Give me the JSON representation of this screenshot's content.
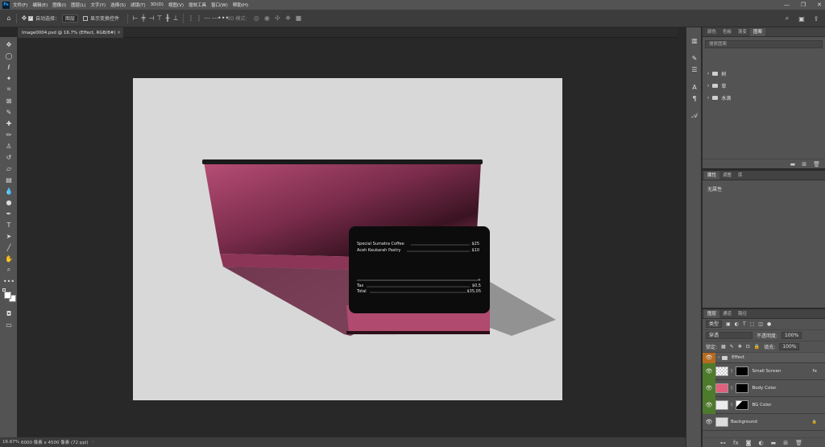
{
  "app": {
    "logo": "Ps"
  },
  "menu": [
    "文件(F)",
    "编辑(E)",
    "图像(I)",
    "图层(L)",
    "文字(Y)",
    "选择(S)",
    "滤镜(T)",
    "3D(D)",
    "视图(V)",
    "增效工具",
    "窗口(W)",
    "帮助(H)"
  ],
  "window_controls": [
    "—",
    "❐",
    "✕"
  ],
  "options": {
    "auto_select_label": "自动选择：",
    "auto_select_value": "图层",
    "show_transform_label": "显示变换控件",
    "mode_3d_label": "3D 模式："
  },
  "document": {
    "tab_title": "Image0004.psd @ 16.7% (Effect, RGB/8#)",
    "close": "×"
  },
  "receipt": {
    "line1_item": "Special Sumatra Coffee",
    "line1_price": "$25",
    "line2_item": "Aceh Keukarah Pastry",
    "line2_price": "$10",
    "tax_label": "Tax",
    "tax_value": "$0,5",
    "total_label": "Total",
    "total_value": "$35,05",
    "plus": "+"
  },
  "status": {
    "zoom": "16.67%",
    "doc_info": "6000 像素 x 4500 像素 (72 ppi)",
    "arrow": "›"
  },
  "libraries_panel": {
    "tabs": [
      "颜色",
      "色板",
      "渐变",
      "图案"
    ],
    "active_tab": "图案",
    "search_placeholder": "搜索图案",
    "items": [
      "树",
      "草",
      "水滴"
    ]
  },
  "properties_panel": {
    "tabs": [
      "属性",
      "调整",
      "库"
    ],
    "active_tab": "属性",
    "empty_text": "无属性"
  },
  "layers_panel": {
    "tabs": [
      "图层",
      "通道",
      "路径"
    ],
    "active_tab": "图层",
    "filter_label": "类型",
    "blend_mode": "穿透",
    "opacity_label": "不透明度:",
    "opacity_value": "100%",
    "lock_label": "锁定:",
    "fill_label": "填充:",
    "fill_value": "100%",
    "layers": [
      {
        "name": "Effect",
        "type": "group",
        "eye_color": "#b56a1f"
      },
      {
        "name": "Small Screen",
        "fx": "fx",
        "eye_color": "#4e7a2b"
      },
      {
        "name": "Body Color",
        "eye_color": "#4e7a2b",
        "thumb_color": "#e0607d"
      },
      {
        "name": "BG Color",
        "eye_color": "#4e7a2b",
        "thumb_color": "#ececec"
      },
      {
        "name": "Background",
        "eye_color": "",
        "locked": "🔒"
      }
    ]
  },
  "colors": {
    "stand_pink": "#b04a6e",
    "artboard_bg": "#d8d8d8"
  }
}
